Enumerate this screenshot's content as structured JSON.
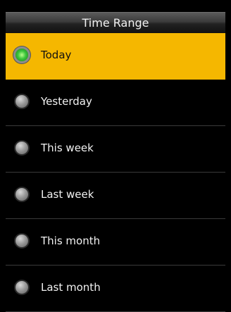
{
  "header": {
    "title": "Time Range"
  },
  "options": [
    {
      "label": "Today",
      "selected": true
    },
    {
      "label": "Yesterday",
      "selected": false
    },
    {
      "label": "This week",
      "selected": false
    },
    {
      "label": "Last week",
      "selected": false
    },
    {
      "label": "This month",
      "selected": false
    },
    {
      "label": "Last month",
      "selected": false
    }
  ],
  "colors": {
    "selected_background": "#f5b700",
    "background": "#000000",
    "text": "#f2f2f2",
    "selected_indicator": "#38c43a"
  }
}
